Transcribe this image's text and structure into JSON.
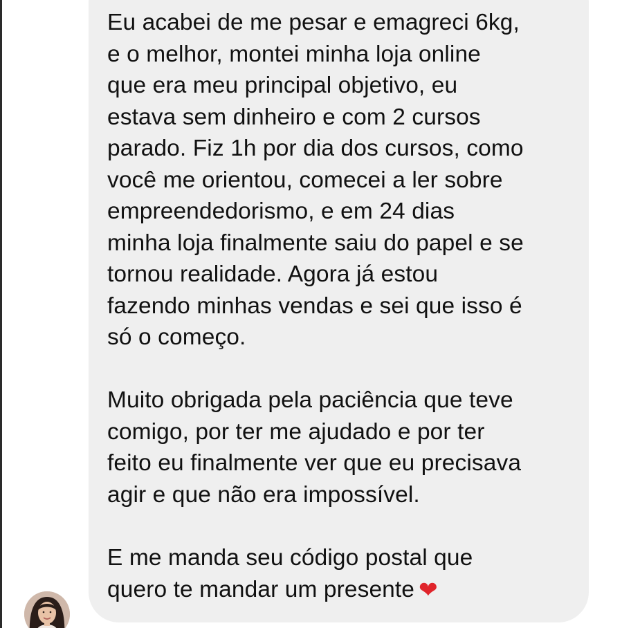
{
  "message": {
    "paragraphs": [
      "Eu acabei de me pesar e emagreci 6kg,\ne o melhor, montei minha loja online\nque era meu principal objetivo, eu\nestava sem dinheiro e com 2 cursos\nparado. Fiz 1h por dia dos cursos, como\nvocê me orientou, comecei a ler sobre\nempreendedorismo, e em 24 dias\nminha loja finalmente saiu do papel e se\ntornou realidade. Agora já estou\nfazendo minhas vendas e sei que isso é\nsó o começo.",
      "Muito obrigada pela paciência que teve\ncomigo, por ter me ajudado e por ter\nfeito eu finalmente ver que eu precisava\nagir e que não era impossível.",
      "E me manda seu código postal que\nquero te mandar um presente"
    ],
    "emoji": "❤",
    "bubble_color": "#efefef",
    "heart_color": "#e0242b"
  },
  "sender": {
    "avatar_icon": "user-avatar"
  }
}
